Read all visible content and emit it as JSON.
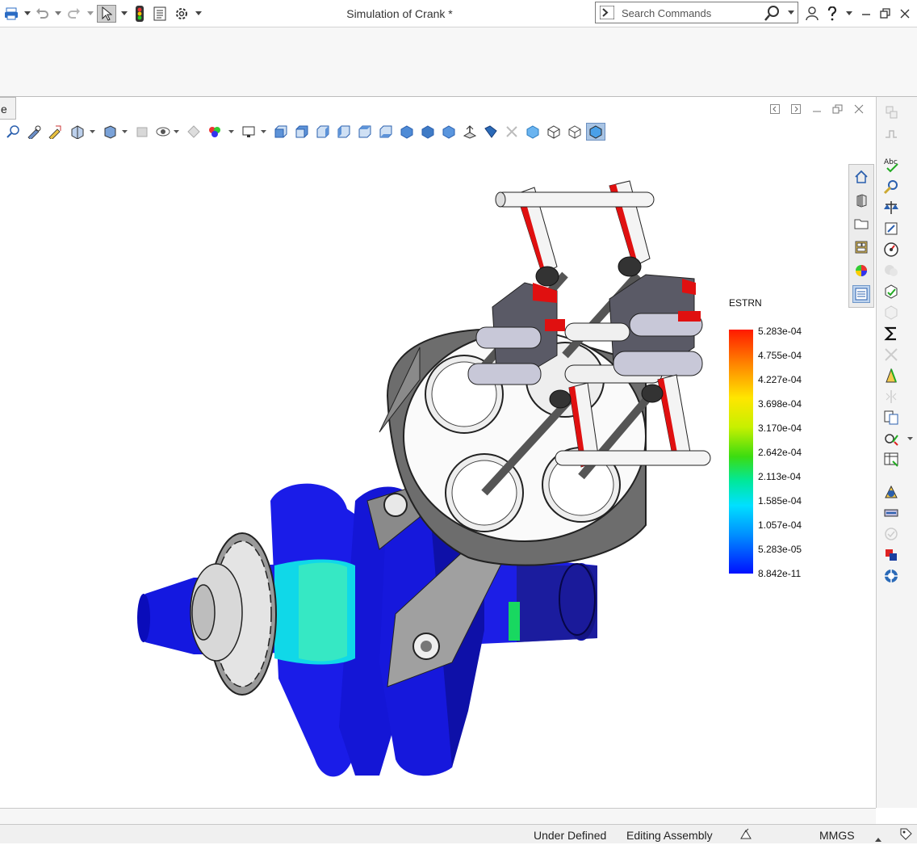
{
  "window": {
    "title": "Simulation of Crank *"
  },
  "search": {
    "placeholder": "Search Commands"
  },
  "doc_tab": {
    "label": "e"
  },
  "legend": {
    "title": "ESTRN",
    "ticks": [
      "5.283e-04",
      "4.755e-04",
      "4.227e-04",
      "3.698e-04",
      "3.170e-04",
      "2.642e-04",
      "2.113e-04",
      "1.585e-04",
      "1.057e-04",
      "5.283e-05",
      "8.842e-11"
    ],
    "colors": {
      "max": "#ff1a00",
      "mid": "#3cdc10",
      "min": "#0010ff"
    }
  },
  "status": {
    "definition": "Under Defined",
    "mode": "Editing Assembly",
    "units": "MMGS"
  },
  "icons": {
    "quick_access": [
      "print-icon",
      "undo-icon",
      "redo-icon",
      "select-icon",
      "rebuild-icon",
      "file-properties-icon",
      "options-icon"
    ],
    "help": [
      "user-icon",
      "help-icon",
      "minimize-icon",
      "restore-icon",
      "close-icon"
    ],
    "task_pane": [
      "home-icon",
      "3d-library-icon",
      "file-explorer-icon",
      "view-palette-icon",
      "appearances-icon",
      "custom-properties-icon"
    ]
  },
  "colors": {
    "accent": "#2b6cc4",
    "model_blue": "#1c1ee6",
    "stress_red": "#e01010"
  }
}
